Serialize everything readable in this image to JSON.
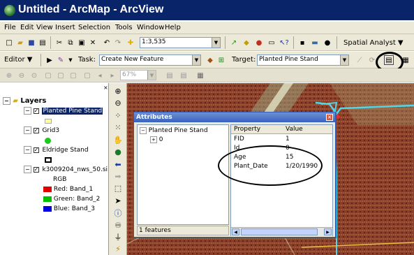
{
  "window": {
    "title": "Untitled - ArcMap - ArcView"
  },
  "menu": [
    "File",
    "Edit",
    "View",
    "Insert",
    "Selection",
    "Tools",
    "Window",
    "Help"
  ],
  "toolbar1": {
    "scale_value": "1:3,535",
    "spatial_analyst_label": "Spatial Analyst ▼"
  },
  "toolbar2": {
    "editor_label": "Editor ▼",
    "task_label": "Task:",
    "task_value": "Create New Feature",
    "target_label": "Target:",
    "target_value": "Planted Pine Stand"
  },
  "toolbar3": {
    "zoom_value": "67%"
  },
  "toc": {
    "root_label": "Layers",
    "layers": [
      {
        "name": "Planted Pine Stand",
        "selected": true
      },
      {
        "name": "Grid3"
      },
      {
        "name": "Eldridge Stand"
      },
      {
        "name": "k3009204_nws_50.si"
      }
    ],
    "rgb_label": "RGB",
    "bands": [
      {
        "name": "Red:",
        "band": "Band_1",
        "color": "#e00000"
      },
      {
        "name": "Green:",
        "band": "Band_2",
        "color": "#00c000"
      },
      {
        "name": "Blue:",
        "band": "Band_3",
        "color": "#0000e0"
      }
    ]
  },
  "attributes": {
    "title": "Attributes",
    "close_label": "×",
    "tree_root": "Planted Pine Stand",
    "tree_child": "0",
    "status": "1 features",
    "headers": {
      "property": "Property",
      "value": "Value"
    },
    "rows": [
      {
        "property": "FID",
        "value": "1"
      },
      {
        "property": "Id",
        "value": "0"
      },
      {
        "property": "Age",
        "value": "15"
      },
      {
        "property": "Plant_Date",
        "value": "1/20/1990"
      }
    ]
  },
  "colors": {
    "title_bar": "#0a246a",
    "highlight_cyan": "#4fd6e8",
    "grid3_marker": "#1ec81e",
    "pine_stand_swatch": "#ffff99"
  },
  "icons": [
    "zoom-in-icon",
    "zoom-out-icon",
    "pan-icon",
    "globe-icon",
    "back-icon",
    "forward-icon",
    "select-arrow-icon",
    "identify-icon",
    "binoculars-icon",
    "measure-icon",
    "hyperlink-icon"
  ]
}
